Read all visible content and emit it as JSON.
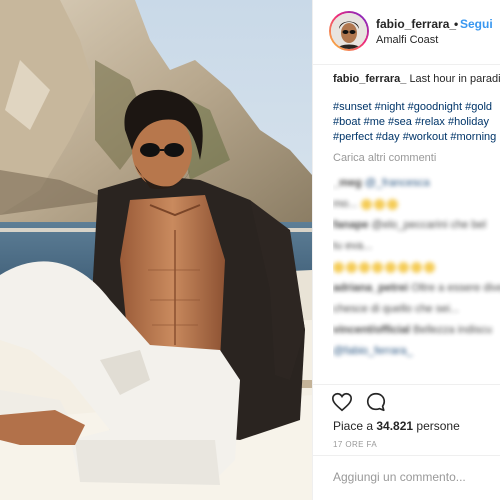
{
  "header": {
    "username": "fabio_ferrara_",
    "separator": "•",
    "follow_label": "Segui",
    "location": "Amalfi Coast"
  },
  "caption": {
    "username": "fabio_ferrara_",
    "text": "Last hour in paradise"
  },
  "hashtags": [
    "#sunset #night #goodnight #gold",
    "#boat #me #sea #relax #holiday",
    "#perfect #day #workout #morning"
  ],
  "load_more_label": "Carica altri commenti",
  "comments": [
    {
      "user": "_meg",
      "text": "@_francesca",
      "extra": "mo..."
    },
    {
      "user": "fanape",
      "text": "@elo_peccarini che bel",
      "extra": "tu eva..."
    },
    {
      "user": "adriana_petrei",
      "text": "Oltre a essere dive",
      "extra": "chesce di quello che sei..."
    },
    {
      "user": "vincent/official",
      "text": "Bellezza indiscu",
      "extra": "@fabio_ferrara_"
    }
  ],
  "likes": {
    "prefix": "Piace a ",
    "count": "34.821",
    "suffix": " persone"
  },
  "timestamp": "17 ORE FA",
  "add_comment": {
    "placeholder": "Aggiungi un commento..."
  },
  "icons": {
    "like": "heart-icon",
    "comment": "comment-icon"
  },
  "colors": {
    "link_blue": "#3897f0",
    "hashtag_blue": "#003569",
    "muted_gray": "#999999"
  }
}
